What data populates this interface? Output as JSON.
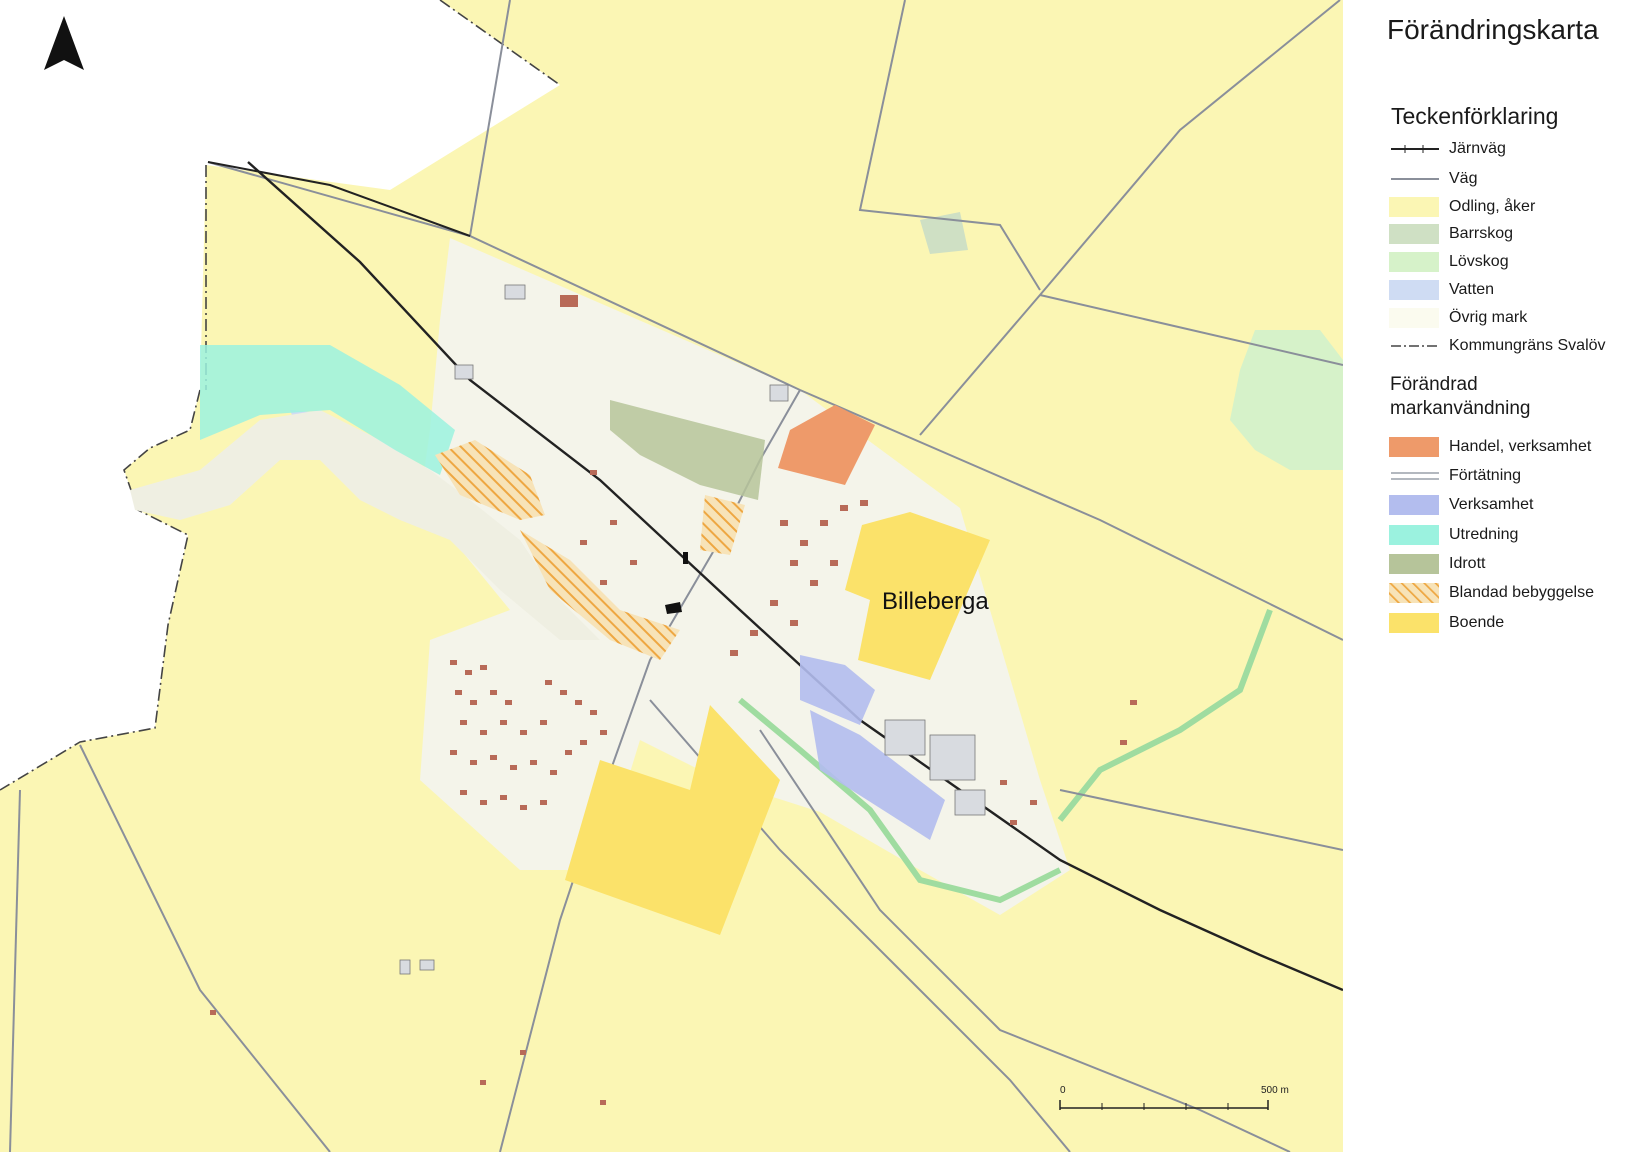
{
  "title": "Förändringskarta",
  "place_label": "Billeberga",
  "legend": {
    "heading": "Teckenförklaring",
    "items": [
      {
        "label": "Järnväg",
        "symbol": "railway-line",
        "color": "#222222"
      },
      {
        "label": "Väg",
        "symbol": "road-line",
        "color": "#8a8f9a"
      },
      {
        "label": "Odling, åker",
        "symbol": "fill",
        "color": "#fbf6b4"
      },
      {
        "label": "Barrskog",
        "symbol": "fill",
        "color": "#cfe0c4"
      },
      {
        "label": "Lövskog",
        "symbol": "fill",
        "color": "#d6f2c9"
      },
      {
        "label": "Vatten",
        "symbol": "fill",
        "color": "#cfdcf3"
      },
      {
        "label": "Övrig mark",
        "symbol": "fill",
        "color": "#fbfbef"
      },
      {
        "label": "Kommungräns Svalöv",
        "symbol": "boundary-line",
        "color": "#444444"
      }
    ]
  },
  "changed_land_use": {
    "heading": "Förändrad markanvändning",
    "items": [
      {
        "label": "Handel, verksamhet",
        "symbol": "fill",
        "color": "#ee9a6a"
      },
      {
        "label": "Förtätning",
        "symbol": "double-line",
        "color": "#9aa0aa"
      },
      {
        "label": "Verksamhet",
        "symbol": "fill",
        "color": "#b3bdee"
      },
      {
        "label": "Utredning",
        "symbol": "fill",
        "color": "#9bf2df"
      },
      {
        "label": "Idrott",
        "symbol": "fill",
        "color": "#b6c49a"
      },
      {
        "label": "Blandad bebyggelse",
        "symbol": "hatch",
        "color": "#f2b24a"
      },
      {
        "label": "Boende",
        "symbol": "fill",
        "color": "#fbe26a"
      }
    ]
  },
  "scale_bar": {
    "start_label": "0",
    "end_label": "500 m"
  },
  "icons": {
    "north_arrow": "north-arrow-icon"
  }
}
